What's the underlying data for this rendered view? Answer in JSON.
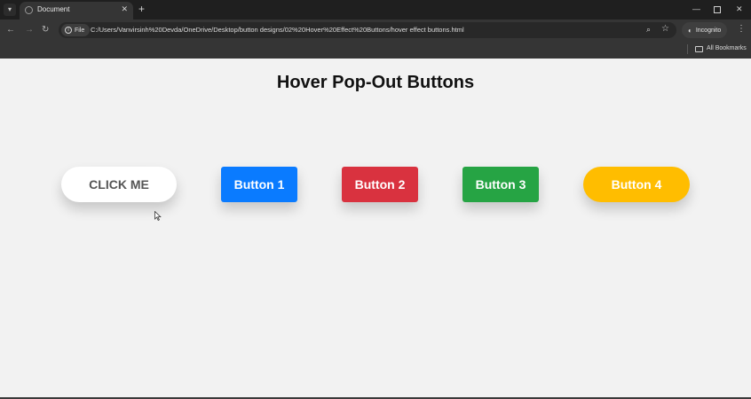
{
  "browser": {
    "tab_title": "Document",
    "tab_close": "✕",
    "new_tab": "+",
    "window_min": "—",
    "window_close": "✕",
    "nav_back": "←",
    "nav_forward": "→",
    "nav_reload": "↻",
    "site_chip_label": "File",
    "url": "C:/Users/Vanvirsinh%20Devda/OneDrive/Desktop/button designs/02%20Hover%20Effect%20Buttons/hover effect buttons.html",
    "incognito_label": "Incognito",
    "menu": "⋮",
    "bookmarks_label": "All Bookmarks"
  },
  "page": {
    "title": "Hover Pop-Out Buttons",
    "buttons": [
      {
        "label": "CLICK ME",
        "color": "#ffffff"
      },
      {
        "label": "Button 1",
        "color": "#0a7bff"
      },
      {
        "label": "Button 2",
        "color": "#d9323f"
      },
      {
        "label": "Button 3",
        "color": "#26a444"
      },
      {
        "label": "Button 4",
        "color": "#ffbd00"
      }
    ]
  }
}
